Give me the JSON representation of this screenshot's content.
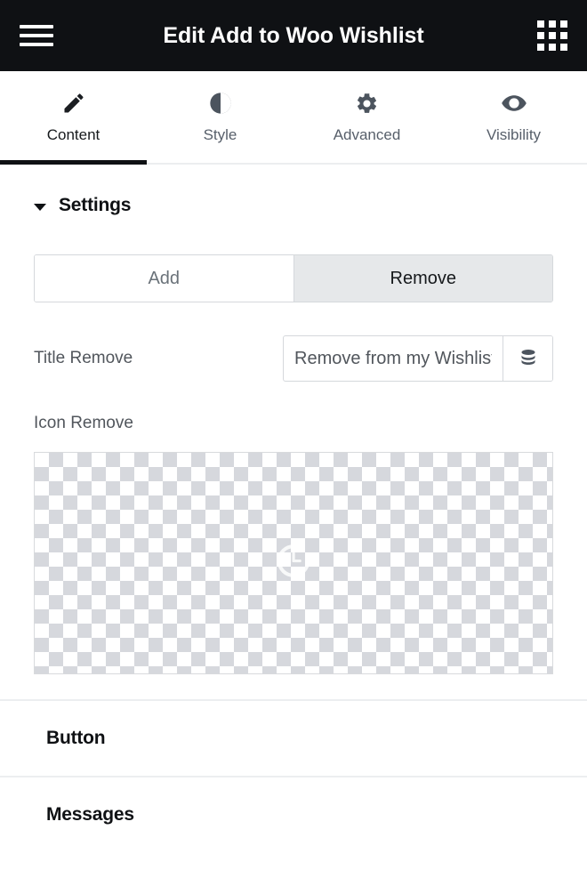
{
  "topbar": {
    "menu_icon": "hamburger-menu-icon",
    "title": "Edit Add to Woo Wishlist",
    "apps_icon": "grid-apps-icon"
  },
  "tabs": [
    {
      "label": "Content",
      "icon": "pencil-icon",
      "active": true
    },
    {
      "label": "Style",
      "icon": "contrast-icon",
      "active": false
    },
    {
      "label": "Advanced",
      "icon": "gear-icon",
      "active": false
    },
    {
      "label": "Visibility",
      "icon": "eye-icon",
      "active": false
    }
  ],
  "settings": {
    "title": "Settings",
    "expanded": true,
    "choices": {
      "add_label": "Add",
      "remove_label": "Remove",
      "selected": "Remove"
    },
    "title_remove": {
      "label": "Title Remove",
      "value": "Remove from my Wishlist",
      "placeholder": "",
      "dynamic_icon": "database-icon"
    },
    "icon_remove": {
      "label": "Icon Remove",
      "preview_state": "empty-transparent-placeholder",
      "preview_icon": "clock-spinner-icon"
    }
  },
  "collapsed_sections": [
    {
      "title": "Button",
      "expanded": false
    },
    {
      "title": "Messages",
      "expanded": false
    }
  ],
  "colors": {
    "topbar_bg": "#0f1114",
    "accent_underline": "#0f1114",
    "label_text": "#51565c",
    "muted_text": "#6a7279",
    "border": "#d5d8dc",
    "selected_bg": "#e6e8ea",
    "checker": "#d6d8dd"
  }
}
